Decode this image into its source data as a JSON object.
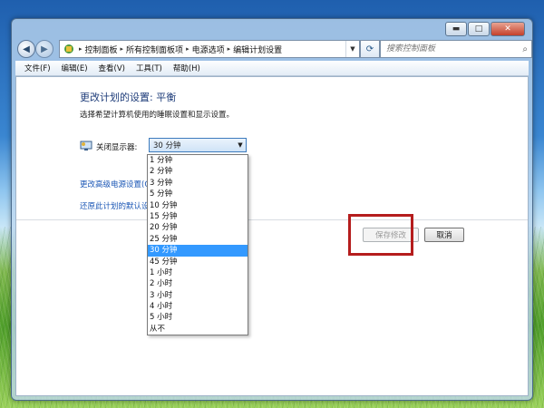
{
  "address_bar": {
    "breadcrumbs": [
      "控制面板",
      "所有控制面板项",
      "电源选项",
      "编辑计划设置"
    ]
  },
  "search": {
    "placeholder": "搜索控制面板"
  },
  "menu": [
    "文件(F)",
    "编辑(E)",
    "查看(V)",
    "工具(T)",
    "帮助(H)"
  ],
  "page": {
    "title": "更改计划的设置: 平衡",
    "subtitle": "选择希望计算机使用的睡眠设置和显示设置。",
    "display_off_label": "关闭显示器:",
    "display_off_value": "30 分钟",
    "link_advanced": "更改高级电源设置(C",
    "link_restore": "还原此计划的默认设"
  },
  "buttons": {
    "save": "保存修改",
    "cancel": "取消"
  },
  "dropdown": {
    "options": [
      "1 分钟",
      "2 分钟",
      "3 分钟",
      "5 分钟",
      "10 分钟",
      "15 分钟",
      "20 分钟",
      "25 分钟",
      "30 分钟",
      "45 分钟",
      "1 小时",
      "2 小时",
      "3 小时",
      "4 小时",
      "5 小时",
      "从不"
    ],
    "selected": "30 分钟"
  },
  "colors": {
    "highlight_box": "#b51d1d",
    "selected_option": "#3399ff",
    "link": "#1a56b5"
  },
  "icons": [
    "back-icon",
    "forward-icon",
    "control-panel-icon",
    "refresh-icon",
    "search-icon",
    "monitor-icon"
  ]
}
